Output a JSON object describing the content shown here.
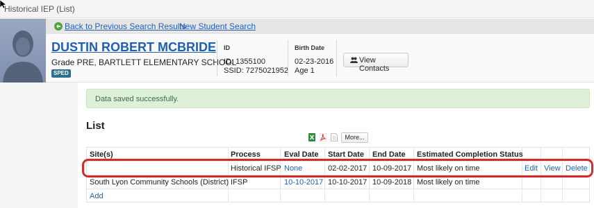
{
  "window": {
    "title": "Historical IEP (List)"
  },
  "nav": {
    "back_label": "Back to Previous Search Results",
    "new_search_label": "New Student Search"
  },
  "student": {
    "name": "DUSTIN ROBERT MCBRIDE",
    "grade_school": "Grade PRE, BARTLETT ELEMENTARY SCHOOL",
    "badge": "SPED",
    "id_label": "ID",
    "id_value": "ID: 1355100",
    "ssid_value": "SSID: 7275021952",
    "birth_label": "Birth Date",
    "birth_value": "02-23-2016",
    "age_value": "Age 1",
    "contacts_button": "View Contacts"
  },
  "alert": {
    "message": "Data saved successfully."
  },
  "list": {
    "title": "List",
    "more_button": "More...",
    "columns": [
      "Site(s)",
      "Process",
      "Eval Date",
      "Start Date",
      "End Date",
      "Estimated Completion Status"
    ],
    "rows": [
      {
        "site": "",
        "process": "Historical IFSP",
        "eval_date": "None",
        "start_date": "02-02-2017",
        "end_date": "10-09-2017",
        "status": "Most likely on time",
        "edit": "Edit",
        "view": "View",
        "delete": "Delete"
      },
      {
        "site": "South Lyon Community Schools (District)",
        "process": "IFSP",
        "eval_date": "10-10-2017",
        "start_date": "10-10-2017",
        "end_date": "10-09-2018",
        "status": "Most likely on time"
      }
    ],
    "add_label": "Add"
  },
  "colors": {
    "link": "#1f5fb5",
    "alert_bg": "#dff0d8",
    "highlight": "#d42a2a",
    "badge": "#2f6f8d"
  },
  "icons": [
    "back-arrow-icon",
    "people-icon",
    "excel-icon",
    "pdf-icon",
    "document-icon",
    "mouse-cursor-icon"
  ]
}
